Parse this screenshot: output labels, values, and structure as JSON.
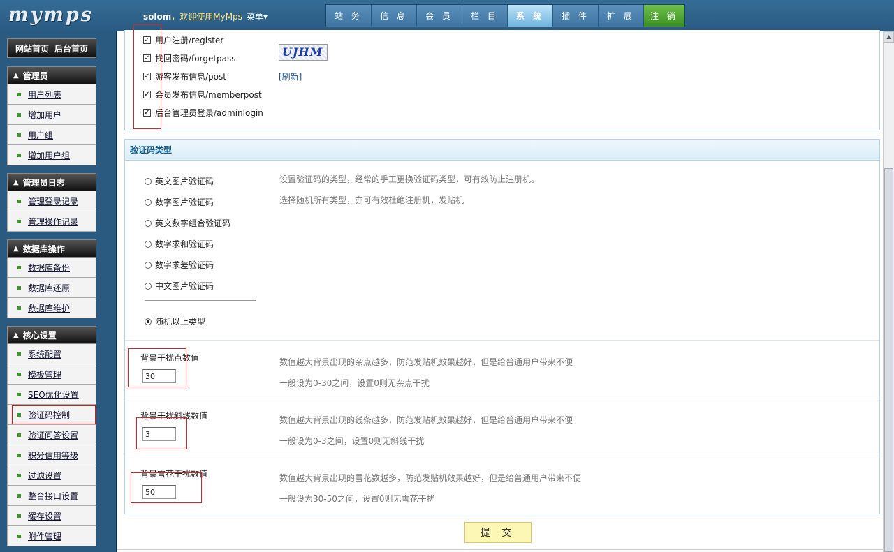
{
  "header": {
    "logo": "mymps",
    "username": "solom",
    "welcome": "，欢迎使用MyMps",
    "menu": "菜单▾",
    "nav": [
      "站 务",
      "信 息",
      "会 员",
      "栏 目",
      "系 统",
      "插 件",
      "扩 展",
      "注 销"
    ],
    "active_nav": "系 统"
  },
  "sidebar": {
    "top_links": [
      "网站首页",
      "后台首页"
    ],
    "groups": [
      {
        "title": "管理员",
        "items": [
          "用户列表",
          "增加用户",
          "用户组",
          "增加用户组"
        ]
      },
      {
        "title": "管理员日志",
        "items": [
          "管理登录记录",
          "管理操作记录"
        ]
      },
      {
        "title": "数据库操作",
        "items": [
          "数据库备份",
          "数据库还原",
          "数据库维护"
        ]
      },
      {
        "title": "核心设置",
        "items": [
          "系统配置",
          "模板管理",
          "SEO优化设置",
          "验证码控制",
          "验证问答设置",
          "积分信用等级",
          "过滤设置",
          "整合接口设置",
          "缓存设置",
          "附件管理"
        ]
      }
    ],
    "selected_item": "验证码控制"
  },
  "captcha_scope": {
    "options": [
      "用户注册/register",
      "找回密码/forgetpass",
      "游客发布信息/post",
      "会员发布信息/memberpost",
      "后台管理员登录/adminlogin"
    ],
    "image_text": "UJHM",
    "refresh": "[刷新]"
  },
  "captcha_type": {
    "title": "验证码类型",
    "options": [
      "英文图片验证码",
      "数字图片验证码",
      "英文数字组合验证码",
      "数字求和验证码",
      "数字求差验证码",
      "中文图片验证码"
    ],
    "random_option": "随机以上类型",
    "desc1": "设置验证码的类型，经常的手工更换验证码类型，可有效防止注册机。",
    "desc2": "选择随机所有类型，亦可有效杜绝注册机，发贴机"
  },
  "fields": [
    {
      "label": "背景干扰点数值",
      "value": "30",
      "desc1": "数值越大背景出现的杂点越多，防范发贴机效果越好，但是给普通用户带来不便",
      "desc2": "一般设为0-30之间，设置0则无杂点干扰"
    },
    {
      "label": "背景干扰斜线数值",
      "value": "3",
      "desc1": "数值越大背景出现的线条越多，防范发贴机效果越好，但是给普通用户带来不便",
      "desc2": "一般设为0-3之间，设置0则无斜线干扰"
    },
    {
      "label": "背景雪花干扰数值",
      "value": "50",
      "desc1": "数值越大背景出现的雪花数越多，防范发贴机效果越好，但是给普通用户带来不便",
      "desc2": "一般设为30-50之间，设置0则无雪花干扰"
    }
  ],
  "submit": "提 交"
}
